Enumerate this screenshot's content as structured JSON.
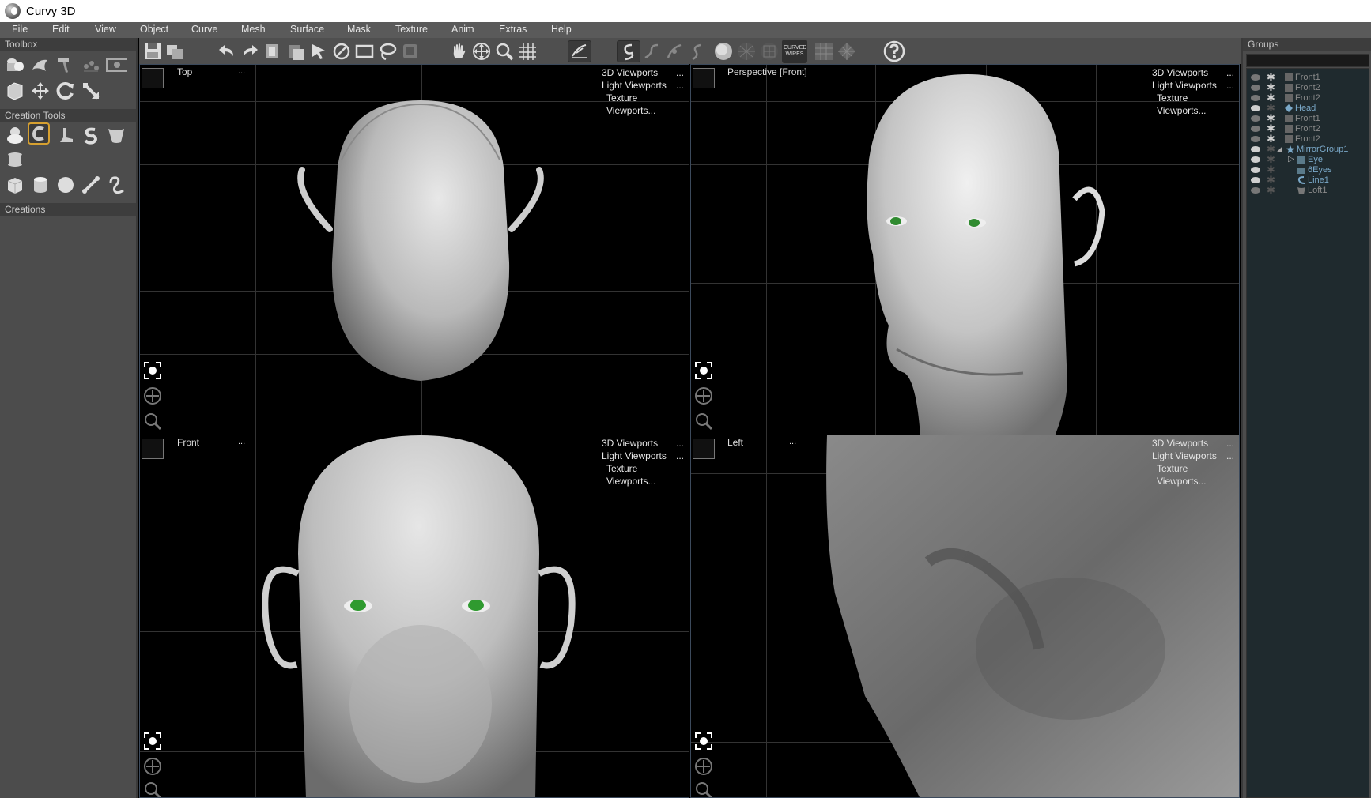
{
  "window": {
    "title": "Curvy 3D"
  },
  "menu": [
    "File",
    "Edit",
    "View",
    "Object",
    "Curve",
    "Mesh",
    "Surface",
    "Mask",
    "Texture",
    "Anim",
    "Extras",
    "Help"
  ],
  "left_panel": {
    "toolbox_header": "Toolbox",
    "creation_tools_header": "Creation Tools",
    "creations_header": "Creations"
  },
  "toolbar": {
    "curved_wires_label": "CURVED WIRES"
  },
  "viewports": {
    "top": {
      "name": "Top",
      "dots": "...",
      "menu": [
        "3D Viewports",
        "Light Viewports",
        "Texture Viewports..."
      ]
    },
    "perspective": {
      "name": "Perspective [Front]",
      "menu": [
        "3D Viewports",
        "Light Viewports",
        "Texture Viewports..."
      ]
    },
    "front": {
      "name": "Front",
      "dots": "...",
      "menu": [
        "3D Viewports",
        "Light Viewports",
        "Texture Viewports..."
      ]
    },
    "left": {
      "name": "Left",
      "dots": "...",
      "menu": [
        "3D Viewports",
        "Light Viewports",
        "Texture Viewports..."
      ]
    },
    "menu_dots": "..."
  },
  "groups": {
    "header": "Groups",
    "items": [
      {
        "name": "Front1"
      },
      {
        "name": "Front2"
      },
      {
        "name": "Front2"
      },
      {
        "name": "Head"
      },
      {
        "name": "Front1"
      },
      {
        "name": "Front2"
      },
      {
        "name": "Front2"
      },
      {
        "name": "MirrorGroup1"
      },
      {
        "name": "Eye"
      },
      {
        "name": "6Eyes"
      },
      {
        "name": "Line1"
      },
      {
        "name": "Loft1"
      }
    ]
  },
  "colors": {
    "accent_selected": "#d6a030",
    "group_text": "#7aa8c8",
    "background": "#000000",
    "panel": "#4c4c4c"
  }
}
